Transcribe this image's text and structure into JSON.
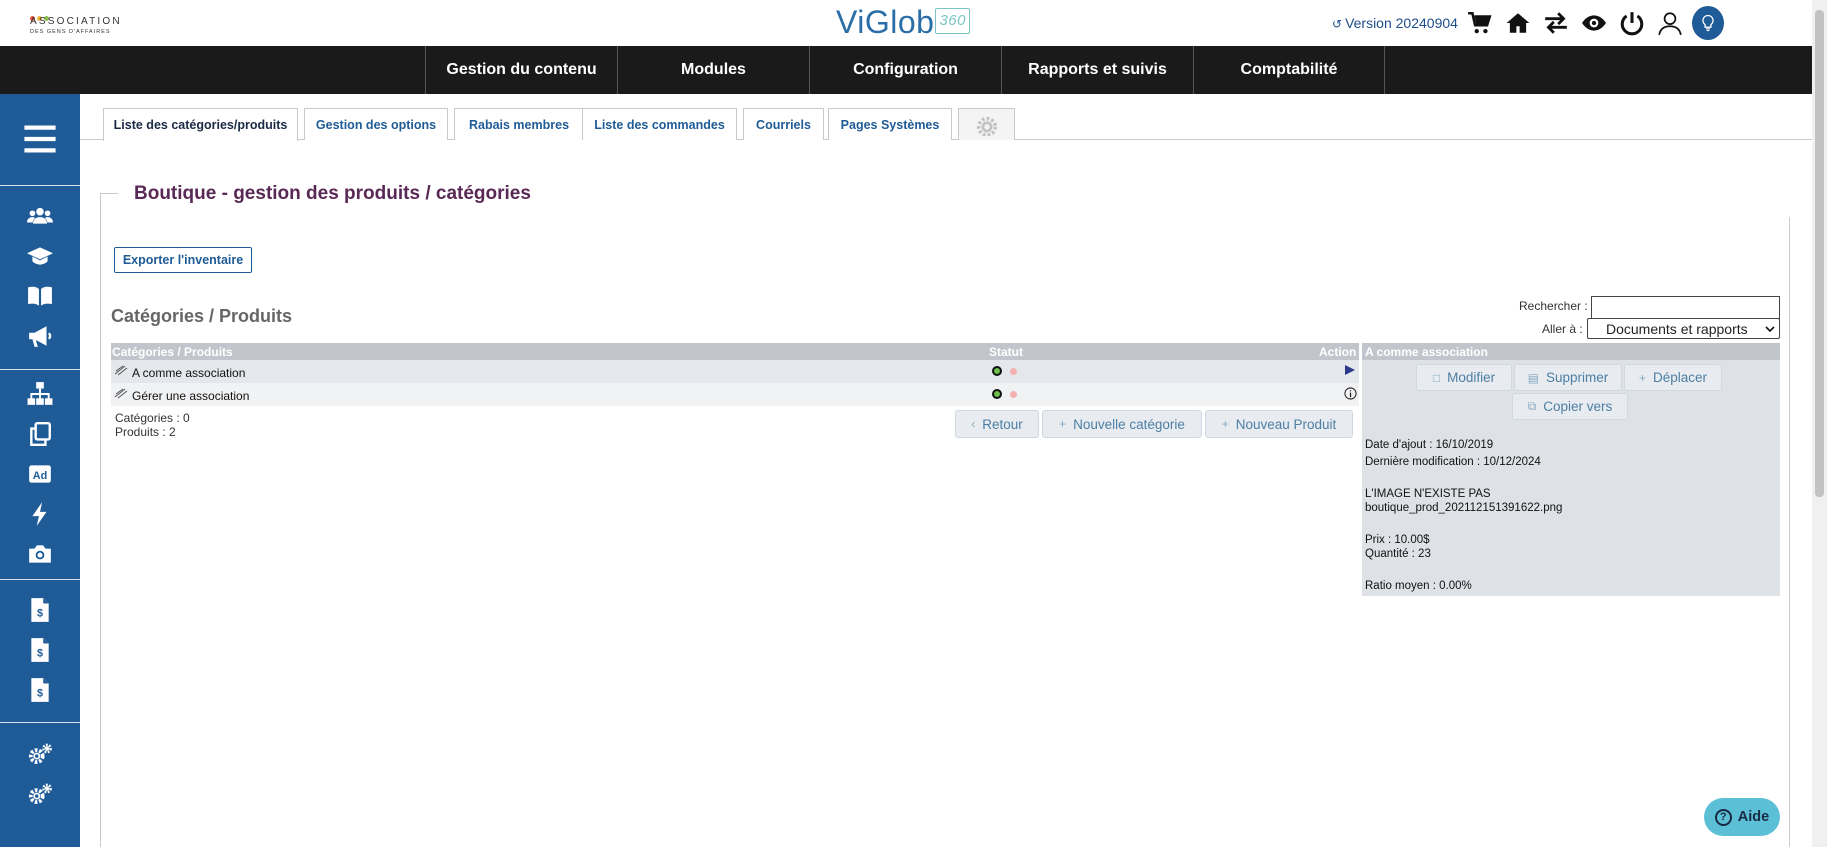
{
  "header": {
    "assoc_logo_name": "ASSOCIATION",
    "assoc_logo_sub": "DES GENS D'AFFAIRES",
    "brand": "ViGlob",
    "brand_badge": "360",
    "version": "Version 20240904",
    "icons": [
      "cart-icon",
      "home-icon",
      "swap-icon",
      "eye-icon",
      "power-icon",
      "user-icon",
      "bulb-avatar-icon"
    ]
  },
  "mainnav": {
    "items": [
      {
        "label": "Gestion du contenu"
      },
      {
        "label": "Modules"
      },
      {
        "label": "Configuration"
      },
      {
        "label": "Rapports et suivis"
      },
      {
        "label": "Comptabilité"
      }
    ]
  },
  "sidebar": {
    "icons": [
      "menu-icon",
      "users-icon",
      "graduation-cap-icon",
      "book-icon",
      "megaphone-icon",
      "sitemap-icon",
      "copy-icon",
      "ad-icon",
      "bolt-icon",
      "camera-icon",
      "invoice-icon",
      "invoice-icon",
      "invoice-icon",
      "gears-icon",
      "gears-icon"
    ]
  },
  "tabs": [
    {
      "label": "Liste des catégories/produits",
      "active": true
    },
    {
      "label": "Gestion des options"
    },
    {
      "label": "Rabais membres"
    },
    {
      "label": "Liste des commandes"
    },
    {
      "label": "Courriels"
    },
    {
      "label": "Pages Systèmes"
    }
  ],
  "page": {
    "title": "Boutique - gestion des produits / catégories",
    "export_label": "Exporter l'inventaire",
    "section_title": "Catégories / Produits",
    "search_label": "Rechercher :",
    "search_value": "",
    "goto_label": "Aller à :",
    "goto_value": "Documents et rapports"
  },
  "table": {
    "headers": {
      "name": "Catégories / Produits",
      "status": "Statut",
      "action": "Action"
    },
    "rows": [
      {
        "label": "A comme association",
        "action_icon": "play-icon"
      },
      {
        "label": "Gérer une association",
        "action_icon": "info-icon"
      }
    ],
    "counts": {
      "categories": "Catégories : 0",
      "products": "Produits : 2"
    },
    "buttons": {
      "back": "Retour",
      "new_category": "Nouvelle catégorie",
      "new_product": "Nouveau Produit"
    }
  },
  "detail": {
    "title": "A comme association",
    "buttons": {
      "modify": "Modifier",
      "delete": "Supprimer",
      "move": "Déplacer",
      "copy": "Copier vers"
    },
    "date_added": "Date d'ajout : 16/10/2019",
    "last_modified": "Dernière modification : 10/12/2024",
    "image_missing": "L'IMAGE N'EXISTE PAS",
    "image_file": "boutique_prod_202112151391622.png",
    "price": "Prix : 10.00$",
    "quantity": "Quantité : 23",
    "ratio": "Ratio moyen : 0.00%"
  },
  "help": {
    "label": "Aide"
  },
  "colors": {
    "nav_bg": "#1a1a1a",
    "sidebar_bg": "#1f5b96",
    "title": "#5a2855",
    "accent": "#1f5b96",
    "help_bg": "#5bc0d6"
  }
}
